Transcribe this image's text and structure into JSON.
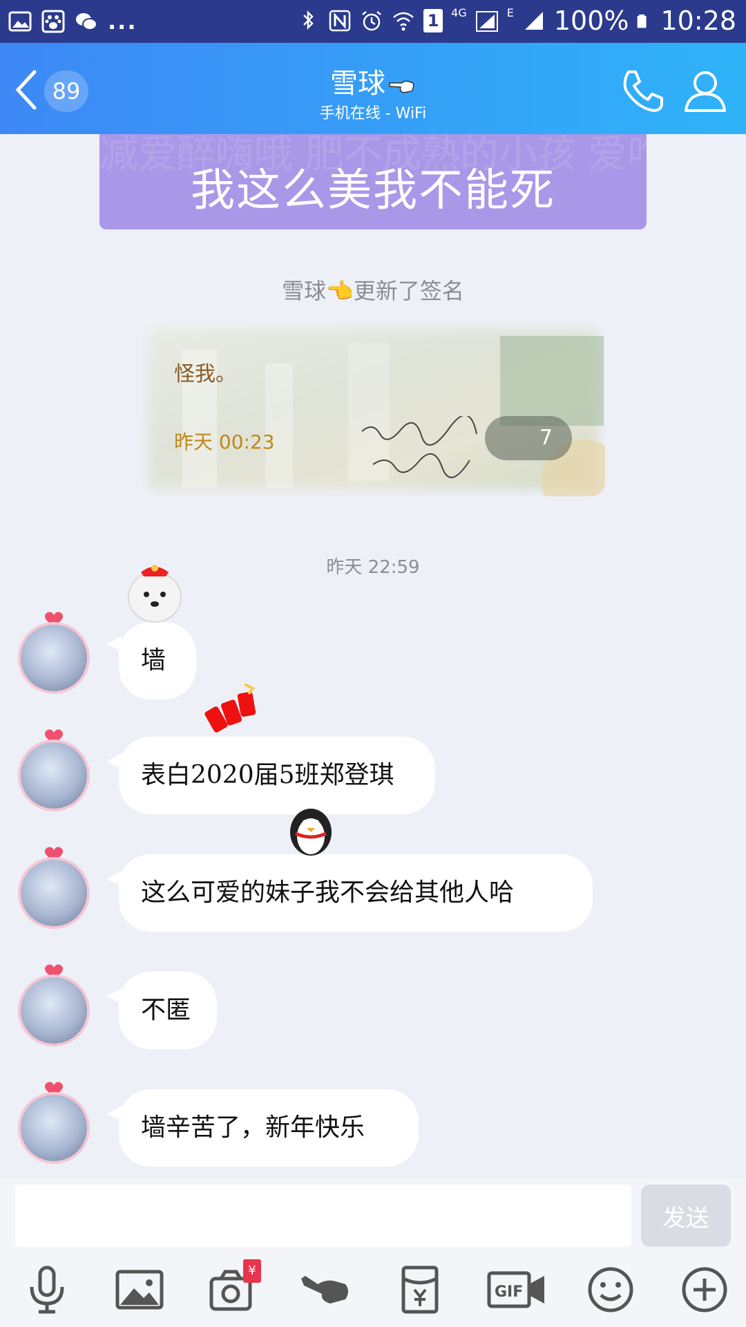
{
  "status_bar": {
    "net_4g": "4G",
    "net_e": "E",
    "sim_badge": "1",
    "dots": "...",
    "battery": "100%",
    "time": "10:28"
  },
  "header": {
    "unread_count": "89",
    "contact_name": "雪球",
    "contact_status": "手机在线 - WiFi"
  },
  "banner": {
    "text": "我这么美我不能死",
    "background_text": "减爱醉嗨哦 肥不成熟的小孩 爱咋咋地肥燥燥燥起来"
  },
  "system_notice": "雪球👈更新了签名",
  "signature_card": {
    "text": "怪我。",
    "time": "昨天 00:23",
    "count": "7"
  },
  "timestamp": "昨天 22:59",
  "messages": [
    {
      "text": "墙"
    },
    {
      "text": "表白2020届5班郑登琪"
    },
    {
      "text": "这么可爱的妹子我不会给其他人哈"
    },
    {
      "text": "不匿"
    },
    {
      "text": "墙辛苦了，新年快乐"
    }
  ],
  "input": {
    "value": "",
    "placeholder": "",
    "send_label": "发送"
  },
  "toolbar_badge": "¥",
  "colors": {
    "status_bar": "#2b3a8c",
    "header_start": "#3d88f6",
    "header_end": "#2fb3f8",
    "banner": "#a998e8",
    "background": "#eef0f7"
  }
}
